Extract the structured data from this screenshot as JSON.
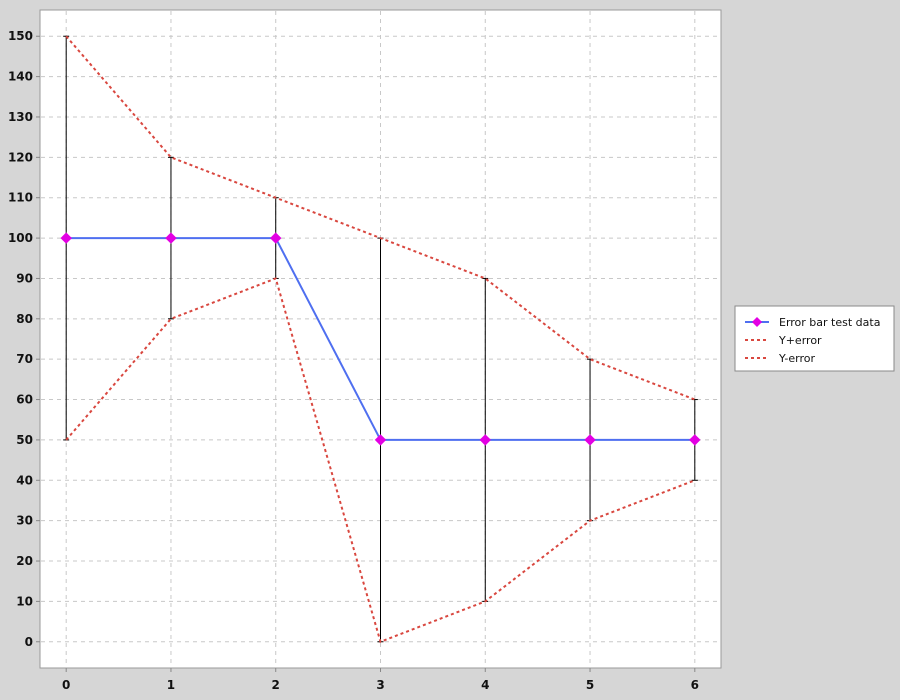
{
  "chart_data": {
    "type": "line",
    "x": [
      0,
      1,
      2,
      3,
      4,
      5,
      6
    ],
    "series": [
      {
        "name": "Error bar test data",
        "values": [
          100,
          100,
          100,
          50,
          50,
          50,
          50
        ],
        "color": "#4f6ff0",
        "marker": "diamond",
        "marker_color": "#e300e3"
      },
      {
        "name": "Y+error",
        "values": [
          150,
          120,
          110,
          100,
          90,
          70,
          60
        ],
        "color": "#d9473f",
        "dashed": true
      },
      {
        "name": "Y-error",
        "values": [
          50,
          80,
          90,
          0,
          10,
          30,
          40
        ],
        "color": "#d9473f",
        "dashed": true
      }
    ],
    "error_bars": {
      "upper": [
        150,
        120,
        110,
        100,
        90,
        70,
        60
      ],
      "lower": [
        50,
        80,
        90,
        0,
        10,
        30,
        40
      ],
      "color": "#000000"
    },
    "xlim": [
      -0.25,
      6.25
    ],
    "ylim": [
      -6.5,
      156.5
    ],
    "x_ticks": [
      0,
      1,
      2,
      3,
      4,
      5,
      6
    ],
    "y_ticks": [
      0,
      10,
      20,
      30,
      40,
      50,
      60,
      70,
      80,
      90,
      100,
      110,
      120,
      130,
      140,
      150
    ],
    "grid": true,
    "legend_position": "right",
    "title": "",
    "xlabel": "",
    "ylabel": ""
  },
  "colors": {
    "background": "#d6d6d6",
    "plot_background": "#ffffff",
    "grid": "#c8c8c8"
  }
}
